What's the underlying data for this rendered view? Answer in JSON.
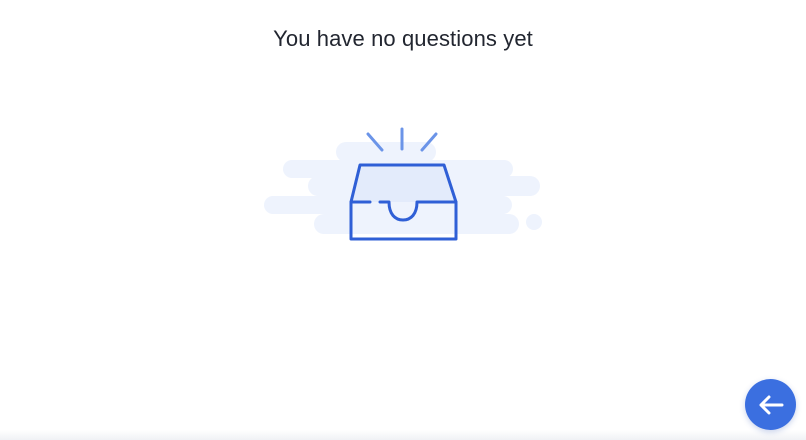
{
  "empty_state": {
    "title": "You have no questions yet",
    "illustration_icon": "empty-inbox-tray-icon"
  },
  "fab": {
    "icon": "arrow-left-icon",
    "color": "#3b6fe0"
  },
  "colors": {
    "accent": "#2f5fd6",
    "cloud": "#eef3fd",
    "title_text": "#222630"
  }
}
